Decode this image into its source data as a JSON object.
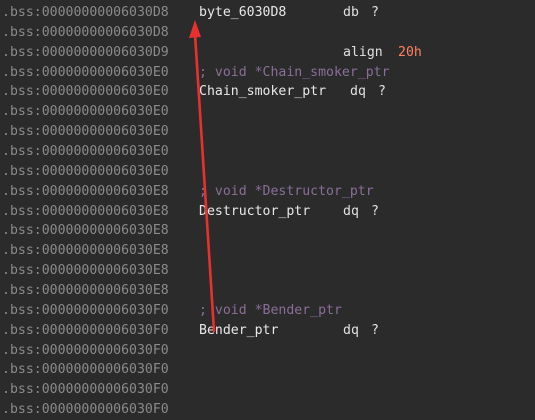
{
  "listing": [
    {
      "addr": ".bss:00000000006030D8",
      "label": "byte_6030D8",
      "mnem": "db",
      "operand": "?",
      "operand_style": "white"
    },
    {
      "addr": ".bss:00000000006030D8"
    },
    {
      "addr": ".bss:00000000006030D9",
      "mnem": "align",
      "operand": "20h",
      "operand_style": "num"
    },
    {
      "addr": ".bss:00000000006030E0",
      "comment": "; void *Chain_smoker_ptr"
    },
    {
      "addr": ".bss:00000000006030E0",
      "label": "Chain_smoker_ptr",
      "mnem": "dq",
      "operand": "?",
      "operand_style": "white"
    },
    {
      "addr": ".bss:00000000006030E0"
    },
    {
      "addr": ".bss:00000000006030E0"
    },
    {
      "addr": ".bss:00000000006030E0"
    },
    {
      "addr": ".bss:00000000006030E0"
    },
    {
      "addr": ".bss:00000000006030E8",
      "comment": "; void *Destructor_ptr"
    },
    {
      "addr": ".bss:00000000006030E8",
      "label": "Destructor_ptr",
      "mnem": "dq",
      "operand": "?",
      "operand_style": "white"
    },
    {
      "addr": ".bss:00000000006030E8"
    },
    {
      "addr": ".bss:00000000006030E8"
    },
    {
      "addr": ".bss:00000000006030E8"
    },
    {
      "addr": ".bss:00000000006030E8"
    },
    {
      "addr": ".bss:00000000006030F0",
      "comment": "; void *Bender_ptr"
    },
    {
      "addr": ".bss:00000000006030F0",
      "label": "Bender_ptr",
      "mnem": "dq",
      "operand": "?",
      "operand_style": "white"
    },
    {
      "addr": ".bss:00000000006030F0"
    },
    {
      "addr": ".bss:00000000006030F0"
    },
    {
      "addr": ".bss:00000000006030F0"
    },
    {
      "addr": ".bss:00000000006030F0"
    }
  ],
  "colors": {
    "background": "#2b2b2b",
    "address": "#8a8a8a",
    "label": "#e8e8e8",
    "comment": "#8a6e97",
    "number": "#ff8060",
    "annotation_arrow": "#e8312f"
  },
  "annotation": {
    "type": "arrow",
    "color": "#e8312f"
  }
}
